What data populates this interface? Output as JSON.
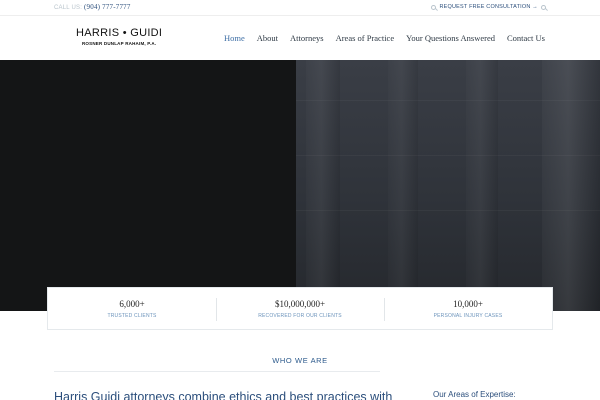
{
  "topbar": {
    "call_label": "CALL US:",
    "phone": "(904) 777-7777",
    "consult_label": "REQUEST FREE CONSULTATION →"
  },
  "logo": {
    "main": "HARRIS • GUIDI",
    "sub": "ROSNER DUNLAP RAHAIM, P.A."
  },
  "nav": {
    "items": [
      "Home",
      "About",
      "Attorneys",
      "Areas of Practice",
      "Your Questions Answered",
      "Contact Us"
    ],
    "active": "Home"
  },
  "stats": [
    {
      "value": "6,000+",
      "caption": "TRUSTED CLIENTS"
    },
    {
      "value": "$10,000,000+",
      "caption": "RECOVERED FOR OUR CLIENTS"
    },
    {
      "value": "10,000+",
      "caption": "PERSONAL INJURY CASES"
    }
  ],
  "who": {
    "heading": "WHO WE ARE",
    "intro": "Harris Guidi attorneys combine ethics and best practices with",
    "areas_heading": "Our Areas of Expertise:"
  },
  "colors": {
    "accent": "#2c4f7c",
    "link_active": "#3d6ea5",
    "hero_dark": "#141516"
  }
}
